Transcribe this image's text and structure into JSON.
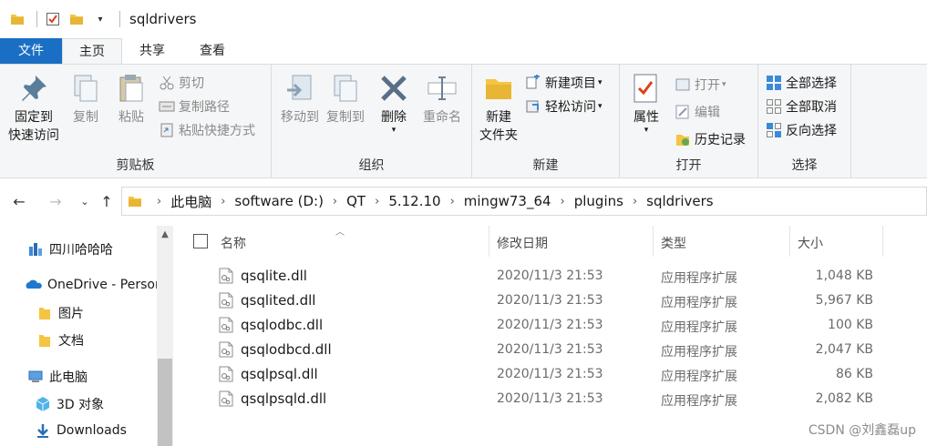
{
  "titlebar": {
    "title": "sqldrivers"
  },
  "tabs": [
    {
      "label": "文件"
    },
    {
      "label": "主页"
    },
    {
      "label": "共享"
    },
    {
      "label": "查看"
    }
  ],
  "ribbon": {
    "clipboard": {
      "label": "剪贴板",
      "pin_line1": "固定到",
      "pin_line2": "快速访问",
      "copy": "复制",
      "paste": "粘贴",
      "cut": "剪切",
      "copy_path": "复制路径",
      "paste_shortcut": "粘贴快捷方式"
    },
    "organize": {
      "label": "组织",
      "move_to": "移动到",
      "copy_to": "复制到",
      "delete": "删除",
      "rename": "重命名"
    },
    "new": {
      "label": "新建",
      "new_folder_line1": "新建",
      "new_folder_line2": "文件夹",
      "new_item": "新建项目",
      "easy_access": "轻松访问"
    },
    "open": {
      "label": "打开",
      "properties": "属性",
      "open": "打开",
      "edit": "编辑",
      "history": "历史记录"
    },
    "select": {
      "label": "选择",
      "select_all": "全部选择",
      "select_none": "全部取消",
      "invert": "反向选择"
    }
  },
  "breadcrumb": [
    "此电脑",
    "software (D:)",
    "QT",
    "5.12.10",
    "mingw73_64",
    "plugins",
    "sqldrivers"
  ],
  "nav": [
    {
      "label": "四川哈哈哈",
      "icon": "quick-access-icon"
    },
    {
      "label": "OneDrive - Personal",
      "icon": "onedrive-icon"
    },
    {
      "label": "图片",
      "icon": "folder-icon"
    },
    {
      "label": "文档",
      "icon": "folder-icon"
    },
    {
      "label": "此电脑",
      "icon": "computer-icon"
    },
    {
      "label": "3D 对象",
      "icon": "3d-objects-icon"
    },
    {
      "label": "Downloads",
      "icon": "download-icon"
    }
  ],
  "columns": {
    "name": "名称",
    "date": "修改日期",
    "type": "类型",
    "size": "大小"
  },
  "files": [
    {
      "name": "qsqlite.dll",
      "date": "2020/11/3 21:53",
      "type": "应用程序扩展",
      "size": "1,048 KB"
    },
    {
      "name": "qsqlited.dll",
      "date": "2020/11/3 21:53",
      "type": "应用程序扩展",
      "size": "5,967 KB"
    },
    {
      "name": "qsqlodbc.dll",
      "date": "2020/11/3 21:53",
      "type": "应用程序扩展",
      "size": "100 KB"
    },
    {
      "name": "qsqlodbcd.dll",
      "date": "2020/11/3 21:53",
      "type": "应用程序扩展",
      "size": "2,047 KB"
    },
    {
      "name": "qsqlpsql.dll",
      "date": "2020/11/3 21:53",
      "type": "应用程序扩展",
      "size": "86 KB"
    },
    {
      "name": "qsqlpsqld.dll",
      "date": "2020/11/3 21:53",
      "type": "应用程序扩展",
      "size": "2,082 KB"
    }
  ],
  "watermark": "CSDN @刘鑫磊up",
  "colors": {
    "accent": "#1a6fc4",
    "folder": "#f4c542",
    "ribbon_bg": "#f5f6f7"
  }
}
